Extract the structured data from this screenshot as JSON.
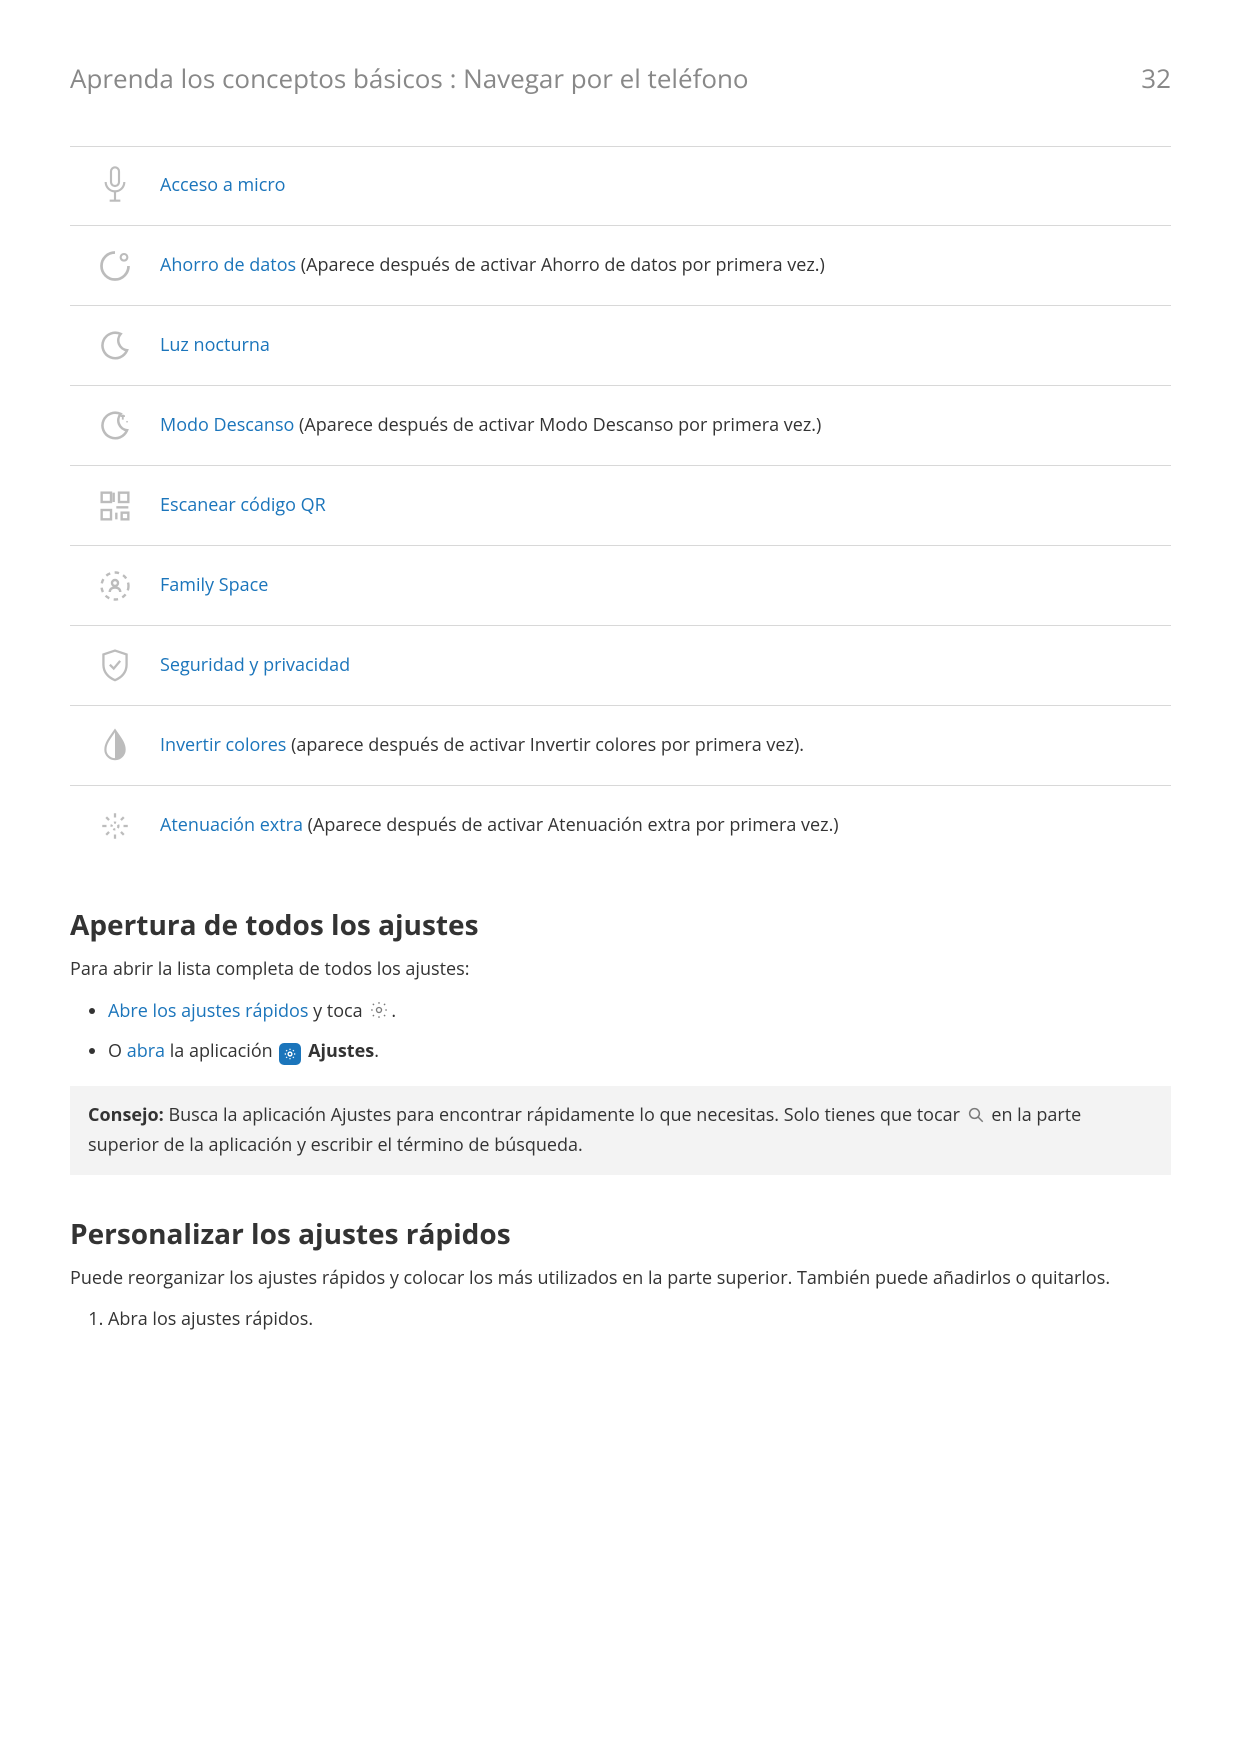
{
  "header": {
    "breadcrumb": "Aprenda los conceptos básicos : Navegar por el teléfono",
    "page_number": "32"
  },
  "quick_settings": [
    {
      "link": "Acceso a micro",
      "note": "",
      "icon": "microphone-icon"
    },
    {
      "link": "Ahorro de datos",
      "note": " (Aparece después de activar Ahorro de datos por primera vez.)",
      "icon": "data-saver-icon"
    },
    {
      "link": "Luz nocturna",
      "note": "",
      "icon": "moon-icon"
    },
    {
      "link": "Modo Descanso",
      "note": " (Aparece después de activar Modo Descanso por primera vez.)",
      "icon": "bedtime-icon"
    },
    {
      "link": "Escanear código QR",
      "note": "",
      "icon": "qr-icon"
    },
    {
      "link": "Family Space",
      "note": "",
      "icon": "family-space-icon"
    },
    {
      "link": "Seguridad y privacidad",
      "note": "",
      "icon": "shield-check-icon"
    },
    {
      "link": "Invertir colores",
      "note": " (aparece después de activar Invertir colores por primera vez).",
      "icon": "invert-colors-icon"
    },
    {
      "link": "Atenuación extra",
      "note": " (Aparece después de activar Atenuación extra por primera vez.)",
      "icon": "extra-dim-icon"
    }
  ],
  "section_open_all": {
    "heading": "Apertura de todos los ajustes",
    "intro": "Para abrir la lista completa de todos los ajustes:",
    "bullet1": {
      "link": "Abre los ajustes rápidos",
      "text_before_icon": " y toca ",
      "text_after_icon": "."
    },
    "bullet2": {
      "prefix": "O ",
      "link": "abra",
      "mid": " la aplicación ",
      "app": "Ajustes",
      "suffix": "."
    },
    "tip": {
      "label": "Consejo:",
      "text_before_icon": " Busca la aplicación Ajustes para encontrar rápidamente lo que necesitas. Solo tienes que tocar ",
      "text_after_icon": " en la parte superior de la aplicación y escribir el término de búsqueda."
    }
  },
  "section_customize": {
    "heading": "Personalizar los ajustes rápidos",
    "intro": "Puede reorganizar los ajustes rápidos y colocar los más utilizados en la parte superior. También puede añadirlos o quitarlos.",
    "step1": "Abra los ajustes rápidos."
  }
}
